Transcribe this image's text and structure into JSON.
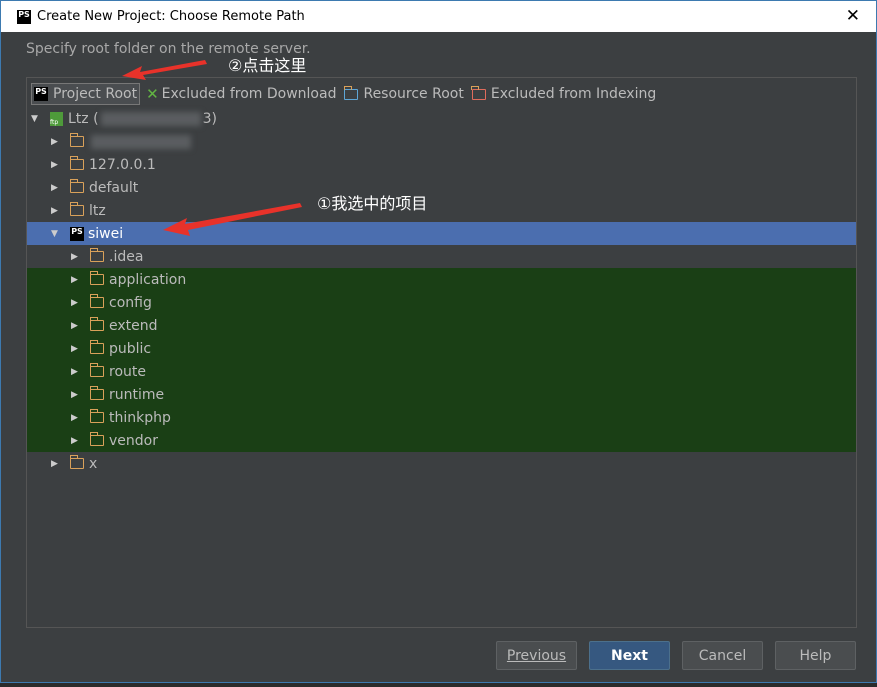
{
  "window": {
    "title": "Create New Project: Choose Remote Path"
  },
  "hint": "Specify root folder on the remote server.",
  "legend": [
    {
      "label": "Project Root",
      "icon": "phpstorm-icon"
    },
    {
      "label": "Excluded from Download",
      "icon": "excluded-icon",
      "color": "#62b543"
    },
    {
      "label": "Resource Root",
      "icon": "folder-icon",
      "color": "#5ea6d6"
    },
    {
      "label": "Excluded from Indexing",
      "icon": "folder-icon",
      "color": "#e06c5c"
    }
  ],
  "tree": [
    {
      "label": "Ltz (",
      "suffix": "3)",
      "depth": 0,
      "expanded": true,
      "icon": "ftp-icon"
    },
    {
      "label": "",
      "depth": 1,
      "blurred": true
    },
    {
      "label": "127.0.0.1",
      "depth": 1
    },
    {
      "label": "default",
      "depth": 1
    },
    {
      "label": "ltz",
      "depth": 1
    },
    {
      "label": "siwei",
      "depth": 1,
      "expanded": true,
      "selected": true,
      "icon": "phpstorm-icon"
    },
    {
      "label": ".idea",
      "depth": 2
    },
    {
      "label": "application",
      "depth": 2,
      "green": true
    },
    {
      "label": "config",
      "depth": 2,
      "green": true
    },
    {
      "label": "extend",
      "depth": 2,
      "green": true
    },
    {
      "label": "public",
      "depth": 2,
      "green": true
    },
    {
      "label": "route",
      "depth": 2,
      "green": true
    },
    {
      "label": "runtime",
      "depth": 2,
      "green": true
    },
    {
      "label": "thinkphp",
      "depth": 2,
      "green": true
    },
    {
      "label": "vendor",
      "depth": 2,
      "green": true
    },
    {
      "label": "x",
      "depth": 1
    }
  ],
  "buttons": {
    "previous": "Previous",
    "next": "Next",
    "cancel": "Cancel",
    "help": "Help"
  },
  "annotations": {
    "click_here": "②点击这里",
    "selected_project": "①我选中的项目"
  },
  "colors": {
    "selection": "#4b6eaf",
    "project_root_content": "#1a3f15",
    "arrow": "#e8322a"
  }
}
